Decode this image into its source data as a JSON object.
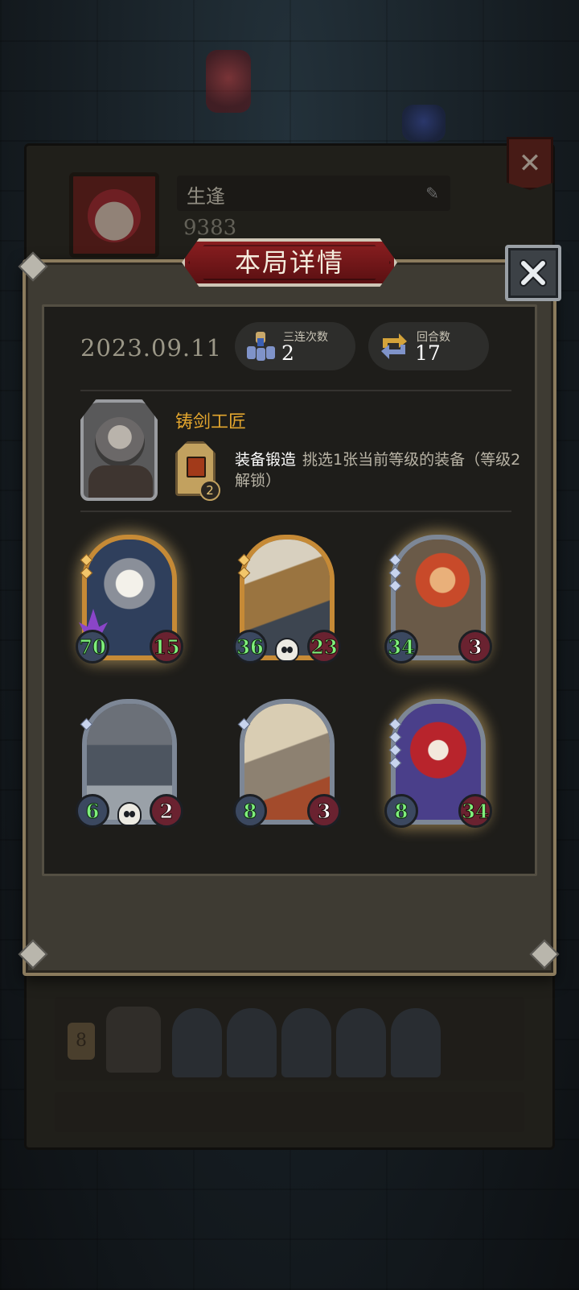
{
  "background": {
    "player_name": "生逢",
    "coins": "9383",
    "close_glyph": "✕",
    "rows": [
      {
        "level": "8"
      }
    ]
  },
  "modal": {
    "title": "本局详情",
    "date": "2023.09.11",
    "stats": [
      {
        "label": "三连次数",
        "value": "2",
        "icon": "triple-units-icon"
      },
      {
        "label": "回合数",
        "value": "17",
        "icon": "rounds-cycle-icon"
      }
    ],
    "hero": {
      "name": "铸剑工匠",
      "skill_name": "装备锻造",
      "skill_desc": "挑选1张当前等级的装备（等级2解锁）",
      "skill_level": "2"
    },
    "cards": [
      {
        "attack": "70",
        "health": "15",
        "frame": "gold",
        "gems": 2,
        "glow": true,
        "skull": false,
        "spike": true,
        "art": "bearded-wizard",
        "health_buffed": true
      },
      {
        "attack": "36",
        "health": "23",
        "frame": "gold",
        "gems": 2,
        "glow": false,
        "skull": true,
        "spike": false,
        "art": "steampunk-drill",
        "health_buffed": true
      },
      {
        "attack": "34",
        "health": "3",
        "frame": "silver",
        "gems": 3,
        "glow": true,
        "skull": false,
        "spike": false,
        "art": "red-haired-archer",
        "health_buffed": false
      },
      {
        "attack": "6",
        "health": "2",
        "frame": "silver",
        "gems": 1,
        "glow": false,
        "skull": true,
        "spike": false,
        "art": "robot-bell",
        "health_buffed": false
      },
      {
        "attack": "8",
        "health": "3",
        "frame": "silver",
        "gems": 1,
        "glow": false,
        "skull": false,
        "spike": false,
        "art": "airship",
        "health_buffed": false
      },
      {
        "attack": "8",
        "health": "34",
        "frame": "silver",
        "gems": 4,
        "glow": true,
        "skull": false,
        "spike": false,
        "art": "clown-jester",
        "health_buffed": true
      }
    ],
    "colors": {
      "title_red": "#8a1e20",
      "hero_name_gold": "#e2a52e",
      "attack_green": "#7ff07c"
    }
  }
}
